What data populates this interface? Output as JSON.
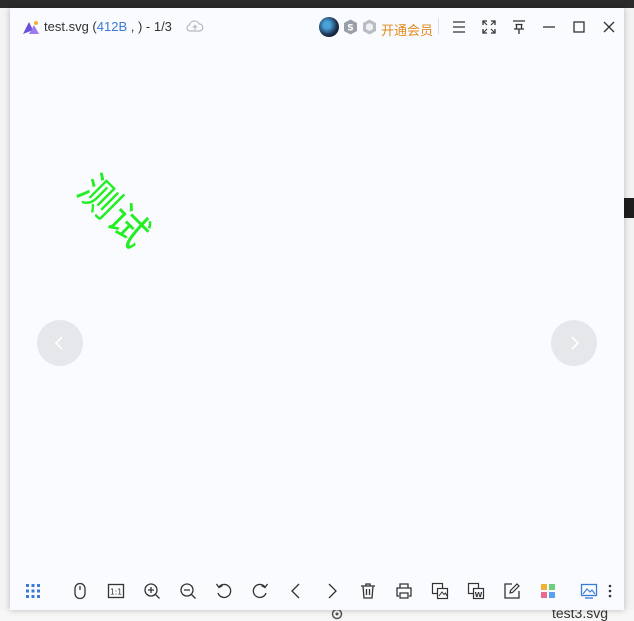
{
  "viewer": {
    "title_name": "test.svg",
    "title_open_paren": " (",
    "title_size": "412B",
    "title_after_size": " , ) - 1/3",
    "vip_label": "开通会员",
    "content_text": "测试",
    "content_color": "#22ee22"
  },
  "background": {
    "file_label": "test3.svg"
  },
  "icons": {
    "title": [
      "app-logo-icon",
      "cloud-upload-icon",
      "avatar",
      "s-badge-icon",
      "vip-badge-icon",
      "menu-icon",
      "fullscreen-icon",
      "pin-icon",
      "minimize-icon",
      "maximize-icon",
      "close-icon"
    ],
    "toolbar": [
      "thumbnail-grid-icon",
      "mouse-icon",
      "actual-size-icon",
      "zoom-in-icon",
      "zoom-out-icon",
      "rotate-left-icon",
      "rotate-right-icon",
      "previous-icon",
      "next-icon",
      "delete-icon",
      "print-icon",
      "convert-image-icon",
      "convert-word-icon",
      "edit-icon",
      "apps-icon",
      "wallpaper-icon",
      "more-icon"
    ]
  },
  "colors": {
    "accent": "#3a7bd5",
    "vip": "#e08a1e",
    "viewer_bg": "#fafbff"
  }
}
